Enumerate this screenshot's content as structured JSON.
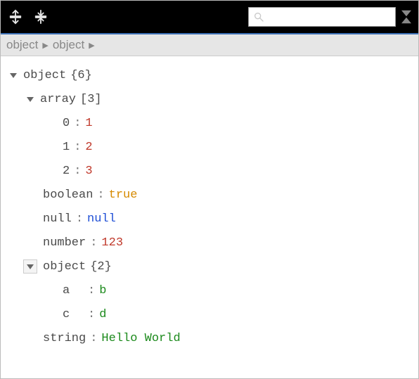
{
  "toolbar": {
    "search_placeholder": ""
  },
  "breadcrumb": {
    "item1": "object",
    "item2": "object"
  },
  "tree": {
    "root_label": "object",
    "root_meta": "{6}",
    "array": {
      "label": "array",
      "meta": "[3]",
      "items": [
        {
          "idx": "0",
          "val": "1"
        },
        {
          "idx": "1",
          "val": "2"
        },
        {
          "idx": "2",
          "val": "3"
        }
      ]
    },
    "boolean": {
      "key": "boolean",
      "val": "true"
    },
    "nullprop": {
      "key": "null",
      "val": "null"
    },
    "number": {
      "key": "number",
      "val": "123"
    },
    "object2": {
      "label": "object",
      "meta": "{2}",
      "items": [
        {
          "k": "a",
          "v": "b"
        },
        {
          "k": "c",
          "v": "d"
        }
      ]
    },
    "string": {
      "key": "string",
      "val": "Hello World"
    }
  }
}
